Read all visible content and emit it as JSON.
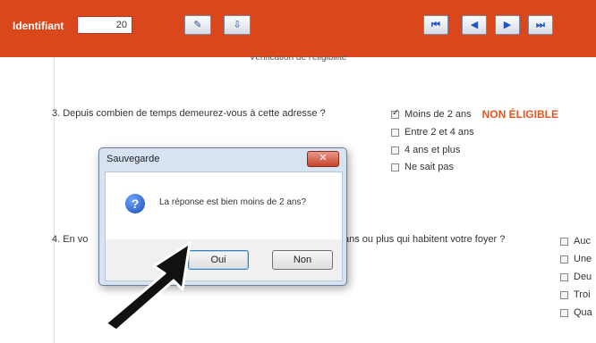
{
  "toolbar": {
    "id_label": "Identifiant",
    "id_value": "20",
    "btn1": "✎",
    "btn2": "⇩",
    "nav": [
      "⏮",
      "◀",
      "▶",
      "⏭"
    ]
  },
  "subtitle": "Vérification de l'éligibilité",
  "q3": {
    "text": "3. Depuis combien de temps demeurez-vous à cette adresse ?",
    "options": [
      "Moins de 2 ans",
      "Entre 2 et 4 ans",
      "4 ans et plus",
      "Ne sait pas"
    ],
    "ineligible": "NON ÉLIGIBLE"
  },
  "q4": {
    "text_left": "4. En vo",
    "text_right": "ans ou plus qui habitent votre foyer ?",
    "options": [
      "Auc",
      "Une",
      "Deu",
      "Troi",
      "Qua"
    ]
  },
  "dialog": {
    "title": "Sauvegarde",
    "close": "✕",
    "icon": "?",
    "message": "La réponse est bien moins de 2 ans?",
    "oui": "Oui",
    "non": "Non"
  },
  "colors": {
    "toolbar": "#d9471a",
    "ineligible": "#e8551c"
  }
}
